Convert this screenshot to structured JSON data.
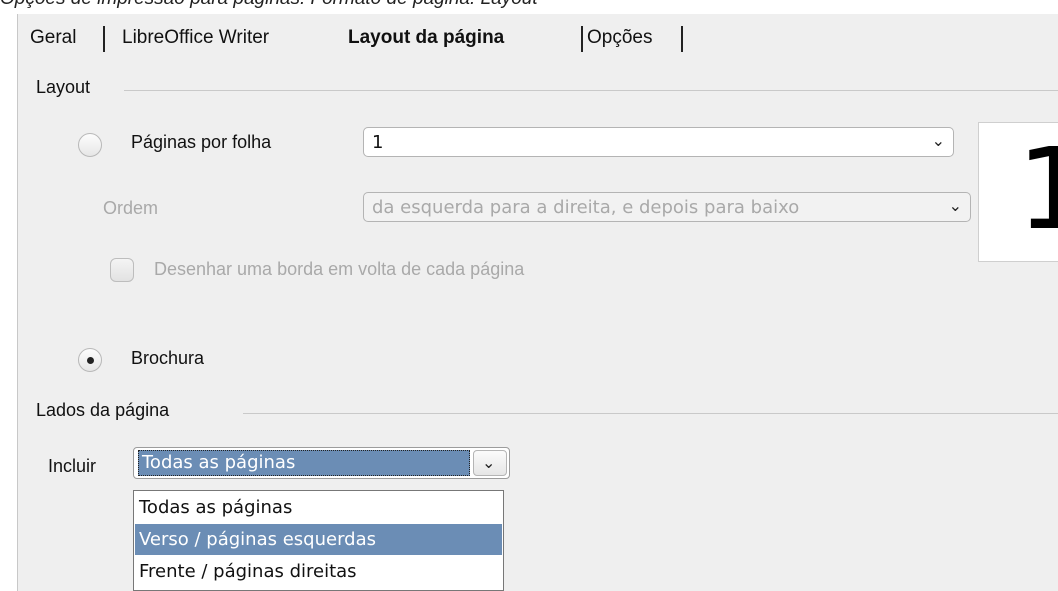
{
  "caption": "Opções de impressão para páginas: Formato de página: Layout",
  "tabs": [
    {
      "label": "Geral"
    },
    {
      "label": "LibreOffice Writer"
    },
    {
      "label": "Layout da página"
    },
    {
      "label": "Opções"
    }
  ],
  "layout_section": {
    "title": "Layout",
    "pages_per_sheet": {
      "label": "Páginas por folha",
      "value": "1"
    },
    "order": {
      "label": "Ordem",
      "value": "da esquerda para a direita, e depois para baixo"
    },
    "border_checkbox": {
      "label": "Desenhar uma borda em volta de cada página",
      "checked": false
    },
    "brochure": {
      "label": "Brochura",
      "selected": true
    },
    "preview_number": "1"
  },
  "page_sides_section": {
    "title": "Lados da página",
    "include": {
      "label": "Incluir",
      "value": "Todas as páginas",
      "options": [
        "Todas as páginas",
        "Verso / páginas esquerdas",
        "Frente / páginas direitas"
      ],
      "highlighted_option": "Verso / páginas esquerdas"
    }
  },
  "colors": {
    "selection": "#6b8db5",
    "dialog_bg": "#efefef"
  }
}
